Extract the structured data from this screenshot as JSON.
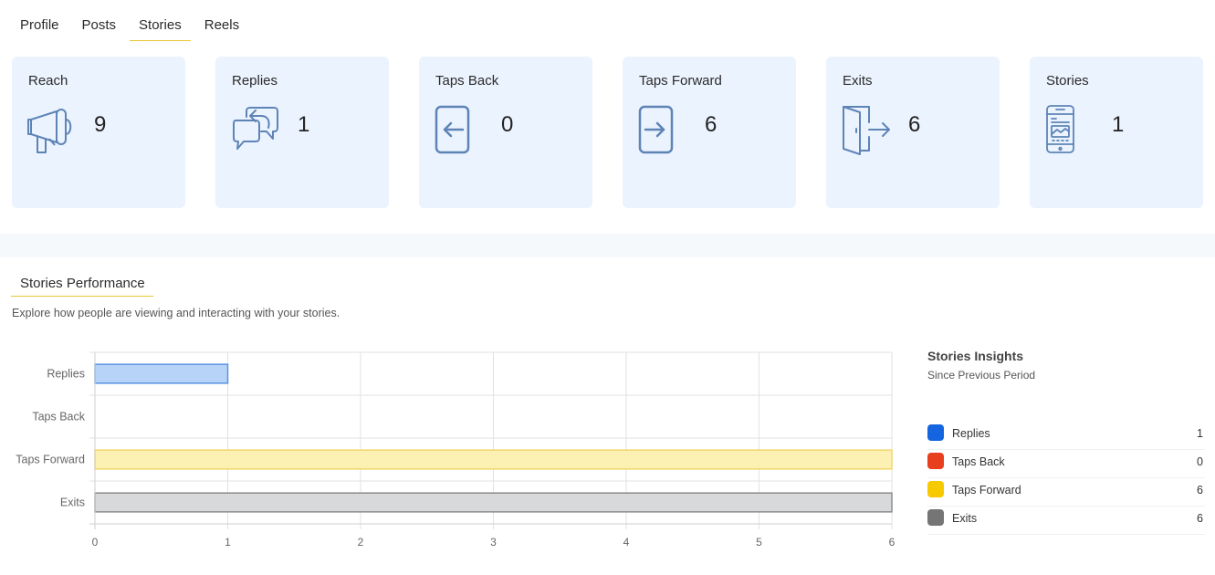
{
  "tabs": [
    {
      "label": "Profile"
    },
    {
      "label": "Posts"
    },
    {
      "label": "Stories",
      "active": true
    },
    {
      "label": "Reels"
    }
  ],
  "cards": [
    {
      "title": "Reach",
      "value": "9",
      "icon": "megaphone-icon"
    },
    {
      "title": "Replies",
      "value": "1",
      "icon": "reply-chat-icon"
    },
    {
      "title": "Taps Back",
      "value": "0",
      "icon": "tap-back-icon"
    },
    {
      "title": "Taps Forward",
      "value": "6",
      "icon": "tap-forward-icon"
    },
    {
      "title": "Exits",
      "value": "6",
      "icon": "exit-door-icon"
    },
    {
      "title": "Stories",
      "value": "1",
      "icon": "phone-story-icon"
    }
  ],
  "section": {
    "title": "Stories Performance",
    "description": "Explore how people are viewing and interacting with your stories."
  },
  "insights": {
    "title": "Stories Insights",
    "subtitle": "Since Previous Period",
    "items": [
      {
        "label": "Replies",
        "value": "1",
        "color": "#1565e0"
      },
      {
        "label": "Taps Back",
        "value": "0",
        "color": "#e8401e"
      },
      {
        "label": "Taps Forward",
        "value": "6",
        "color": "#f7c900"
      },
      {
        "label": "Exits",
        "value": "6",
        "color": "#757575"
      }
    ]
  },
  "chart_data": {
    "type": "bar",
    "orientation": "horizontal",
    "categories": [
      "Replies",
      "Taps Back",
      "Taps Forward",
      "Exits"
    ],
    "values": [
      1,
      0,
      6,
      6
    ],
    "fill_colors": [
      "#b7d3f7",
      "#f5c6bc",
      "#fdf0b3",
      "#d8d9da"
    ],
    "stroke_colors": [
      "#5a93e3",
      "#e8735a",
      "#f2d66a",
      "#8c8c8c"
    ],
    "xlim": [
      0,
      6
    ],
    "xticks": [
      "0",
      "1",
      "2",
      "3",
      "4",
      "5",
      "6"
    ],
    "grid": true,
    "title": "",
    "xlabel": "",
    "ylabel": ""
  }
}
